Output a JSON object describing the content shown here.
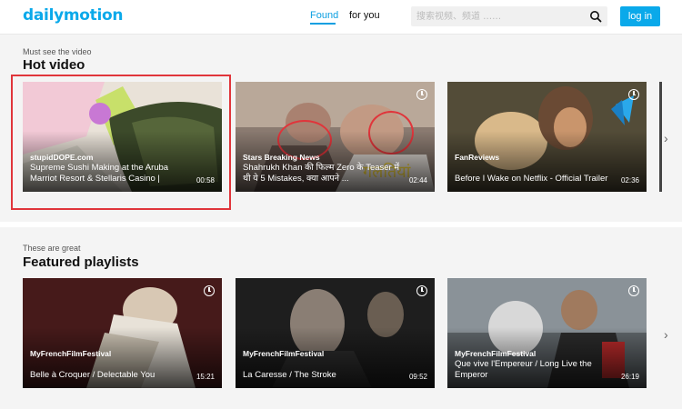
{
  "header": {
    "logo": "dailymotion",
    "nav": [
      {
        "label": "Found",
        "active": true
      },
      {
        "label": "for you",
        "active": false
      }
    ],
    "search_placeholder": "搜索视频、频道 ……",
    "login_label": "log in"
  },
  "colors": {
    "brand": "#0aa9ea",
    "annotation": "#e0353b"
  },
  "hot": {
    "eyebrow": "Must see the video",
    "title": "Hot video",
    "cards": [
      {
        "channel": "stupidDOPE.com",
        "title": "Supreme Sushi Making at the Aruba Marriot Resort & Stellaris Casino |",
        "duration": "00:58"
      },
      {
        "channel": "Stars Breaking News",
        "title": "Shahrukh Khan की फिल्म Zero के Teaser में थी ये 5 Mistakes, क्या आपने ...",
        "duration": "02:44"
      },
      {
        "channel": "FanReviews",
        "title": "Before I Wake on Netflix - Official Trailer",
        "duration": "02:36"
      }
    ]
  },
  "playlists": {
    "eyebrow": "These are great",
    "title": "Featured playlists",
    "cards": [
      {
        "channel": "MyFrenchFilmFestival",
        "title": "Belle à Croquer / Delectable You",
        "duration": "15:21"
      },
      {
        "channel": "MyFrenchFilmFestival",
        "title": "La Caresse / The Stroke",
        "duration": "09:52"
      },
      {
        "channel": "MyFrenchFilmFestival",
        "title": "Que vive l'Empereur / Long Live the Emperor",
        "duration": "26:19"
      }
    ]
  },
  "icons": {
    "next": "chevron-right-icon",
    "watch_later": "clock-icon",
    "search": "search-icon"
  }
}
